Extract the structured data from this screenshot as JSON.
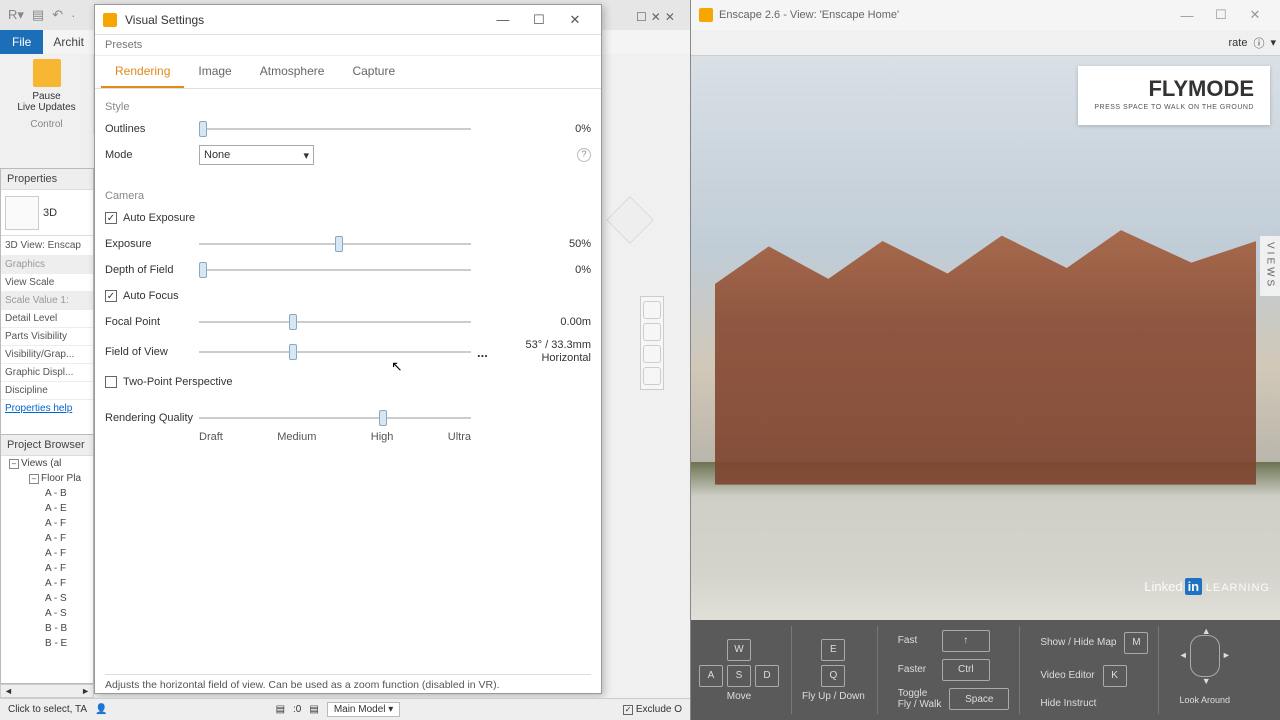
{
  "revit": {
    "file_label": "File",
    "ribbon_tabs": [
      "Archit"
    ],
    "pause": "Pause",
    "live_updates": "Live Updates",
    "control": "Control"
  },
  "properties": {
    "title": "Properties",
    "thumb_label": "3D",
    "view_name": "3D View: Enscap",
    "rows": [
      {
        "label": "Graphics",
        "grey": true
      },
      {
        "label": "View Scale"
      },
      {
        "label": "Scale Value  1:",
        "grey": true
      },
      {
        "label": "Detail Level"
      },
      {
        "label": "Parts Visibility"
      },
      {
        "label": "Visibility/Grap..."
      },
      {
        "label": "Graphic Displ..."
      },
      {
        "label": "Discipline"
      }
    ],
    "help_label": "Properties help"
  },
  "browser": {
    "title": "Project Browser",
    "root": "Views (al",
    "floor_plans": "Floor Pla",
    "items": [
      "A - B",
      "A - E",
      "A - F",
      "A - F",
      "A - F",
      "A - F",
      "A - F",
      "A - S",
      "A - S",
      "B - B",
      "B - E"
    ]
  },
  "vs": {
    "title": "Visual Settings",
    "presets": "Presets",
    "tabs": [
      "Rendering",
      "Image",
      "Atmosphere",
      "Capture"
    ],
    "style": {
      "header": "Style",
      "outlines_label": "Outlines",
      "outlines_value": "0%",
      "mode_label": "Mode",
      "mode_value": "None"
    },
    "camera": {
      "header": "Camera",
      "auto_exposure": "Auto Exposure",
      "exposure_label": "Exposure",
      "exposure_value": "50%",
      "depth_label": "Depth of Field",
      "depth_value": "0%",
      "auto_focus": "Auto Focus",
      "focal_label": "Focal Point",
      "focal_value": "0.00m",
      "fov_label": "Field of View",
      "fov_value1": "53° / 33.3mm",
      "fov_value2": "Horizontal",
      "two_point": "Two-Point Perspective"
    },
    "quality": {
      "header": "Rendering Quality",
      "labels": [
        "Draft",
        "Medium",
        "High",
        "Ultra"
      ]
    },
    "statusbar": "Adjusts the horizontal field of view. Can be used as a zoom function (disabled in VR)."
  },
  "enscape": {
    "title": "Enscape 2.6 - View: 'Enscape Home'",
    "toolbar_item": "rate",
    "flymode_title": "FLYMODE",
    "flymode_sub": "PRESS SPACE TO WALK ON THE GROUND",
    "views_tab": "VIEWS",
    "controls": {
      "move": "Move",
      "fast": "Fast",
      "faster": "Faster",
      "fly_up_down": "Fly Up / Down",
      "toggle": "Toggle",
      "fly_walk": "Fly / Walk",
      "show_hide": "Show / Hide Map",
      "video_editor": "Video Editor",
      "hide_instr": "Hide Instruct",
      "look": "Look Around",
      "keys": {
        "w": "W",
        "a": "A",
        "s": "S",
        "d": "D",
        "e": "E",
        "q": "Q",
        "shift": "↑",
        "ctrl": "Ctrl",
        "space": "Space",
        "m": "M",
        "k": "K"
      }
    },
    "linkedin": "Linked",
    "learning": "LEARNING"
  },
  "statusbar": {
    "click": "Click to select, TA",
    "main_model": "Main Model",
    "exclude": "Exclude O",
    "zero": ":0"
  },
  "chart_data": {
    "type": "table",
    "title": "Visual Settings — Rendering tab controls",
    "rows": [
      {
        "control": "Outlines",
        "value": "0%",
        "position_pct": 0
      },
      {
        "control": "Mode",
        "value": "None"
      },
      {
        "control": "Auto Exposure",
        "value": true
      },
      {
        "control": "Exposure",
        "value": "50%",
        "position_pct": 50
      },
      {
        "control": "Depth of Field",
        "value": "0%",
        "position_pct": 0
      },
      {
        "control": "Auto Focus",
        "value": true
      },
      {
        "control": "Focal Point",
        "value": "0.00m",
        "position_pct": 33
      },
      {
        "control": "Field of View",
        "value": "53° / 33.3mm Horizontal",
        "position_pct": 33
      },
      {
        "control": "Two-Point Perspective",
        "value": false
      },
      {
        "control": "Rendering Quality",
        "value": "High",
        "options": [
          "Draft",
          "Medium",
          "High",
          "Ultra"
        ]
      }
    ]
  }
}
